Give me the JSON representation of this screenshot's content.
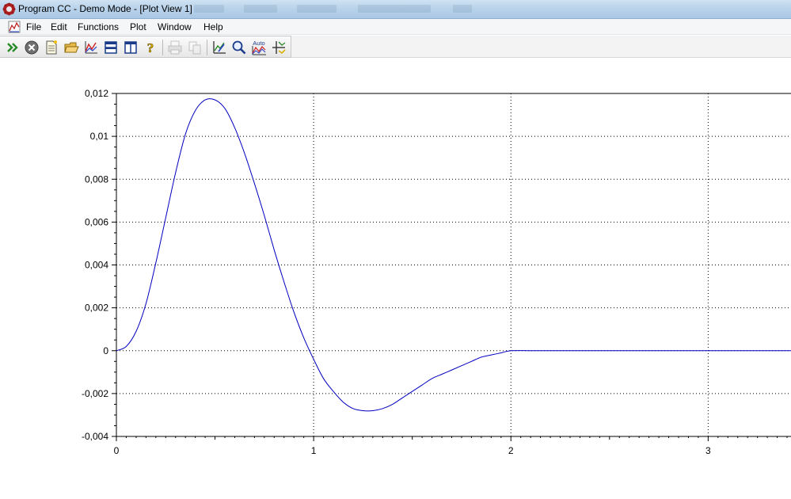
{
  "window": {
    "title": "Program CC - Demo Mode - [Plot View 1]"
  },
  "menu": {
    "items": [
      "File",
      "Edit",
      "Functions",
      "Plot",
      "Window",
      "Help"
    ]
  },
  "toolbar": {
    "buttons": [
      {
        "name": "run-icon"
      },
      {
        "name": "stop-icon"
      },
      {
        "name": "new-document-icon"
      },
      {
        "name": "open-folder-icon"
      },
      {
        "name": "plot-icon"
      },
      {
        "name": "tile-horizontal-icon"
      },
      {
        "name": "tile-vertical-icon"
      },
      {
        "name": "help-icon"
      },
      {
        "name": "print-icon",
        "disabled": true
      },
      {
        "name": "copy-icon",
        "disabled": true
      },
      {
        "name": "axis-settings-icon"
      },
      {
        "name": "zoom-icon"
      },
      {
        "name": "auto-scale-icon",
        "label": "Auto"
      },
      {
        "name": "crosshair-tracker-icon"
      }
    ]
  },
  "chart_data": {
    "type": "line",
    "title": "",
    "xlabel": "",
    "ylabel": "",
    "xlim": [
      0,
      3.42
    ],
    "ylim": [
      -0.004,
      0.012
    ],
    "grid": true,
    "x_ticks": [
      "0",
      "1",
      "2",
      "3"
    ],
    "y_ticks": [
      "0,012",
      "0,01",
      "0,008",
      "0,006",
      "0,004",
      "0,002",
      "0",
      "-0,002",
      "-0,004"
    ],
    "series": [
      {
        "color": "#0000c0",
        "x": [
          0,
          0.05,
          0.1,
          0.15,
          0.2,
          0.25,
          0.3,
          0.35,
          0.4,
          0.45,
          0.5,
          0.55,
          0.6,
          0.65,
          0.7,
          0.75,
          0.8,
          0.85,
          0.9,
          0.95,
          1.0,
          1.05,
          1.1,
          1.15,
          1.2,
          1.25,
          1.3,
          1.35,
          1.4,
          1.45,
          1.5,
          1.55,
          1.6,
          1.65,
          1.7,
          1.75,
          1.8,
          1.85,
          1.9,
          1.95,
          2.0,
          2.1,
          2.2,
          2.3,
          2.4,
          2.5,
          2.6,
          2.8,
          3.0,
          3.2,
          3.42
        ],
        "values": [
          0,
          0.0002,
          0.0009,
          0.0022,
          0.0041,
          0.0062,
          0.0083,
          0.0101,
          0.0112,
          0.0117,
          0.0117,
          0.0113,
          0.0104,
          0.0092,
          0.0078,
          0.0063,
          0.0047,
          0.0032,
          0.0018,
          0.0006,
          -0.0004,
          -0.0013,
          -0.0019,
          -0.0024,
          -0.0027,
          -0.0028,
          -0.0028,
          -0.0027,
          -0.0025,
          -0.0022,
          -0.0019,
          -0.0016,
          -0.0013,
          -0.0011,
          -0.0009,
          -0.0007,
          -0.0005,
          -0.0003,
          -0.0002,
          -0.0001,
          0,
          0,
          0,
          0,
          0,
          0,
          0,
          0,
          0,
          0,
          0
        ]
      }
    ]
  }
}
